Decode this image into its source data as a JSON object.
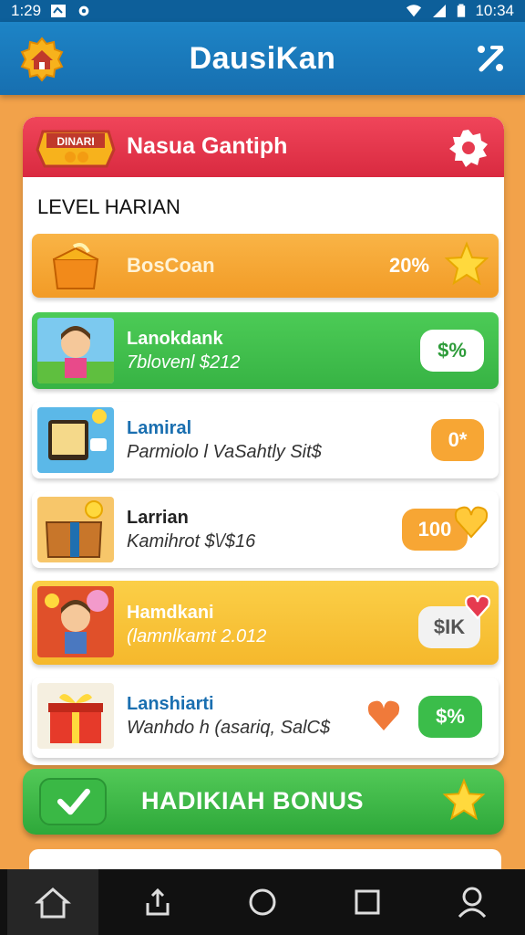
{
  "status_bar": {
    "time_left": "1:29",
    "time_right": "10:34"
  },
  "app": {
    "title": "DausiKan"
  },
  "panel": {
    "badge_text": "DINARI",
    "title": "Nasua Gantiph",
    "section_label": "LEVEL HARIAN",
    "progress_row": {
      "label": "BosCoan",
      "percent_text": "20%",
      "progress": 0.2
    },
    "items": [
      {
        "title": "Lanokdank",
        "subtitle": "7blovenl $212",
        "action": "$%",
        "theme": "green"
      },
      {
        "title": "Lamiral",
        "subtitle": "Parmiolo l VaSahtly Sit$",
        "action": "0*",
        "theme": "white"
      },
      {
        "title": "Larrian",
        "subtitle": "Kamihrot $\\/$16",
        "action": "100",
        "theme": "white"
      },
      {
        "title": "Hamdkani",
        "subtitle": "(lamnlkamt 2.012",
        "action": "$IK",
        "theme": "yellow"
      },
      {
        "title": "Lanshiarti",
        "subtitle": "Wanhdo h (asariq, SalC$",
        "action": "$%",
        "theme": "white"
      }
    ]
  },
  "bonus": {
    "label": "HADIKIAH BONUS"
  },
  "colors": {
    "app_bar": "#1a7dbf",
    "header_red": "#e63a4f",
    "green": "#3bbd4a",
    "orange": "#f7a634",
    "yellow": "#f7c23a",
    "background": "#f2a24a"
  },
  "icons": [
    "home-icon",
    "menu-icon",
    "gear-icon",
    "star-icon",
    "check-icon",
    "heart-icon",
    "nav-home-icon",
    "nav-share-icon",
    "nav-circle-icon",
    "nav-square-icon",
    "nav-profile-icon"
  ]
}
